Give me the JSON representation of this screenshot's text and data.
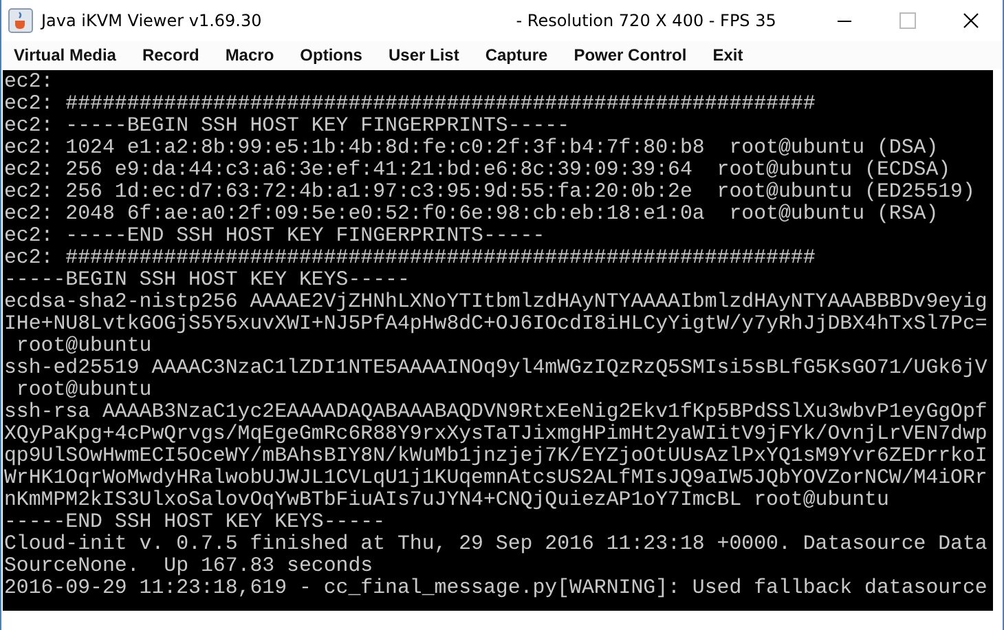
{
  "window": {
    "title": "Java iKVM Viewer v1.69.30",
    "status": "- Resolution 720 X 400 - FPS 35"
  },
  "menu": [
    "Virtual Media",
    "Record",
    "Macro",
    "Options",
    "User List",
    "Capture",
    "Power Control",
    "Exit"
  ],
  "terminal": {
    "lines": [
      "ec2:",
      "ec2: #############################################################",
      "ec2: -----BEGIN SSH HOST KEY FINGERPRINTS-----",
      "ec2: 1024 e1:a2:8b:99:e5:1b:4b:8d:fe:c0:2f:3f:b4:7f:80:b8  root@ubuntu (DSA)",
      "ec2: 256 e9:da:44:c3:a6:3e:ef:41:21:bd:e6:8c:39:09:39:64  root@ubuntu (ECDSA)",
      "ec2: 256 1d:ec:d7:63:72:4b:a1:97:c3:95:9d:55:fa:20:0b:2e  root@ubuntu (ED25519)",
      "ec2: 2048 6f:ae:a0:2f:09:5e:e0:52:f0:6e:98:cb:eb:18:e1:0a  root@ubuntu (RSA)",
      "ec2: -----END SSH HOST KEY FINGERPRINTS-----",
      "ec2: #############################################################",
      "-----BEGIN SSH HOST KEY KEYS-----",
      "ecdsa-sha2-nistp256 AAAAE2VjZHNhLXNoYTItbmlzdHAyNTYAAAAIbmlzdHAyNTYAAABBBDv9eyig",
      "IHe+NU8LvtkGOGjS5Y5xuvXWI+NJ5PfA4pHw8dC+OJ6IOcdI8iHLCyYigtW/y7yRhJjDBX4hTxSl7Pc=",
      " root@ubuntu",
      "ssh-ed25519 AAAAC3NzaC1lZDI1NTE5AAAAINOq9yl4mWGzIQzRzQ5SMIsi5sBLfG5KsGO71/UGk6jV",
      " root@ubuntu",
      "ssh-rsa AAAAB3NzaC1yc2EAAAADAQABAAABAQDVN9RtxEeNig2Ekv1fKp5BPdSSlXu3wbvP1eyGgOpf",
      "XQyPaKpg+4cPwQrvgs/MqEgeGmRc6R88Y9rxXysTaTJixmgHPimHt2yaWIitV9jFYk/OvnjLrVEN7dwp",
      "qp9UlSOwHwmECI5OceWY/mBAhsBIY8N/kWuMb1jnzjej7K/EYZjoOtUUsAzlPxYQ1sM9Yvr6ZEDrrkoI",
      "WrHK1OqrWoMwdyHRalwobUJWJL1CVLqU1j1KUqemnAtcsUS2ALfMIsJQ9aIW5JQbYOVZorNCW/M4iORr",
      "nKmMPM2kIS3UlxoSalovOqYwBTbFiuAIs7uJYN4+CNQjQuiezAP1oY7ImcBL root@ubuntu",
      "-----END SSH HOST KEY KEYS-----",
      "Cloud-init v. 0.7.5 finished at Thu, 29 Sep 2016 11:23:18 +0000. Datasource Data",
      "SourceNone.  Up 167.83 seconds",
      "2016-09-29 11:23:18,619 - cc_final_message.py[WARNING]: Used fallback datasource"
    ]
  }
}
